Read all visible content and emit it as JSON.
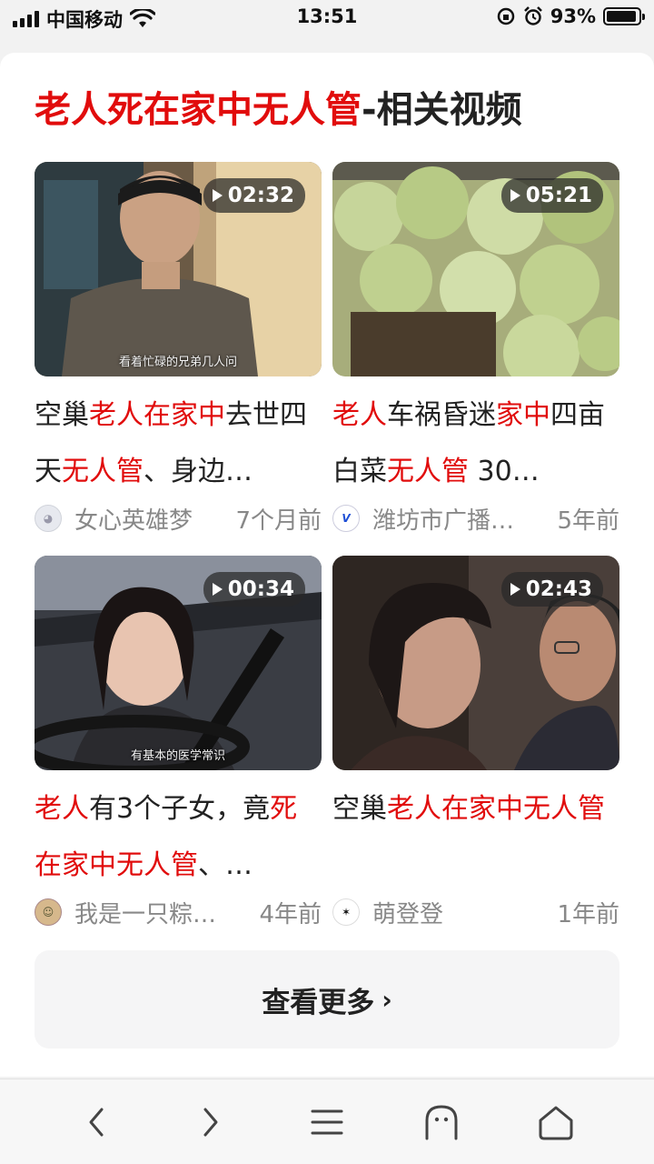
{
  "status_bar": {
    "carrier": "中国移动",
    "time": "13:51",
    "battery_percent": "93%",
    "battery_level": 0.93
  },
  "section": {
    "title_highlight": "老人死在家中无人管",
    "title_rest": "-相关视频"
  },
  "videos": [
    {
      "duration": "02:32",
      "subtitle": "看着忙碌的兄弟几人问",
      "title_parts": [
        {
          "text": "空巢",
          "red": false
        },
        {
          "text": "老人在家中",
          "red": true
        },
        {
          "text": "去世四天",
          "red": false
        },
        {
          "text": "无人管",
          "red": true
        },
        {
          "text": "、身边…",
          "red": false
        }
      ],
      "author": "女心英雄梦",
      "time": "7个月前",
      "avatar_icon": "cartoon-face-icon"
    },
    {
      "duration": "05:21",
      "subtitle": "",
      "title_parts": [
        {
          "text": "老人",
          "red": true
        },
        {
          "text": "车祸昏迷",
          "red": false
        },
        {
          "text": "家中",
          "red": true
        },
        {
          "text": "四亩白菜",
          "red": false
        },
        {
          "text": "无人管",
          "red": true
        },
        {
          "text": " 30…",
          "red": false
        }
      ],
      "author": "潍坊市广播…",
      "time": "5年前",
      "avatar_text": "V",
      "avatar_icon": "v-logo-icon"
    },
    {
      "duration": "00:34",
      "subtitle": "有基本的医学常识",
      "title_parts": [
        {
          "text": "老人",
          "red": true
        },
        {
          "text": "有3个子女，竟",
          "red": false
        },
        {
          "text": "死在家中无人管",
          "red": true
        },
        {
          "text": "、…",
          "red": false
        }
      ],
      "author": "我是一只粽…",
      "time": "4年前",
      "avatar_icon": "cartoon-avatar-icon"
    },
    {
      "duration": "02:43",
      "subtitle": "",
      "title_parts": [
        {
          "text": "空巢",
          "red": false
        },
        {
          "text": "老人在家中无人管",
          "red": true
        }
      ],
      "author": "萌登登",
      "time": "1年前",
      "avatar_icon": "anime-avatar-icon"
    }
  ],
  "more_button": {
    "label": "查看更多",
    "chevron": "›"
  },
  "colors": {
    "highlight": "#e10c0c",
    "text": "#222222",
    "meta": "#888888"
  }
}
